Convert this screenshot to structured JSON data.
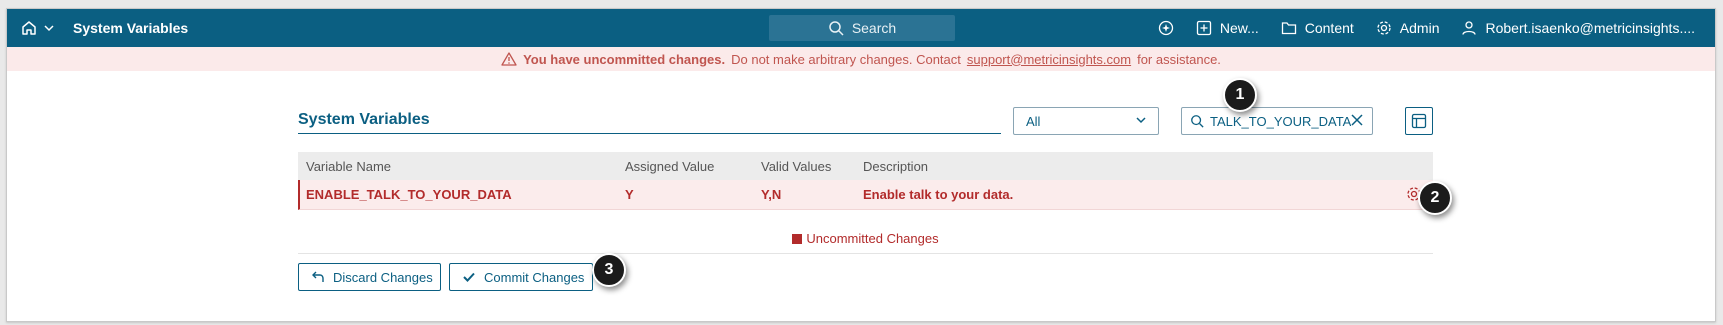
{
  "topbar": {
    "title": "System Variables",
    "search_label": "Search",
    "nav": {
      "new_label": "New...",
      "content_label": "Content",
      "admin_label": "Admin",
      "user_label": "Robert.isaenko@metricinsights...."
    }
  },
  "banner": {
    "strong_text": "You have uncommitted changes.",
    "text_before_link": "Do not make arbitrary changes. Contact",
    "link_text": "support@metricinsights.com",
    "text_after_link": "for assistance."
  },
  "panel": {
    "title": "System Variables",
    "filter_select_value": "All",
    "filter_text_value": "TALK_TO_YOUR_DATA"
  },
  "table": {
    "columns": [
      "Variable Name",
      "Assigned Value",
      "Valid Values",
      "Description"
    ],
    "rows": [
      {
        "name": "ENABLE_TALK_TO_YOUR_DATA",
        "assigned_value": "Y",
        "valid_values": "Y,N",
        "description": "Enable talk to your data."
      }
    ]
  },
  "legend": {
    "label": "Uncommitted Changes",
    "color": "#b22b2b"
  },
  "actions": {
    "discard_label": "Discard Changes",
    "commit_label": "Commit Changes"
  },
  "callouts": [
    "1",
    "2",
    "3"
  ],
  "colors": {
    "header_bg": "#0b5f82",
    "banner_bg": "#fbeaea",
    "accent_red": "#b22b2b"
  }
}
